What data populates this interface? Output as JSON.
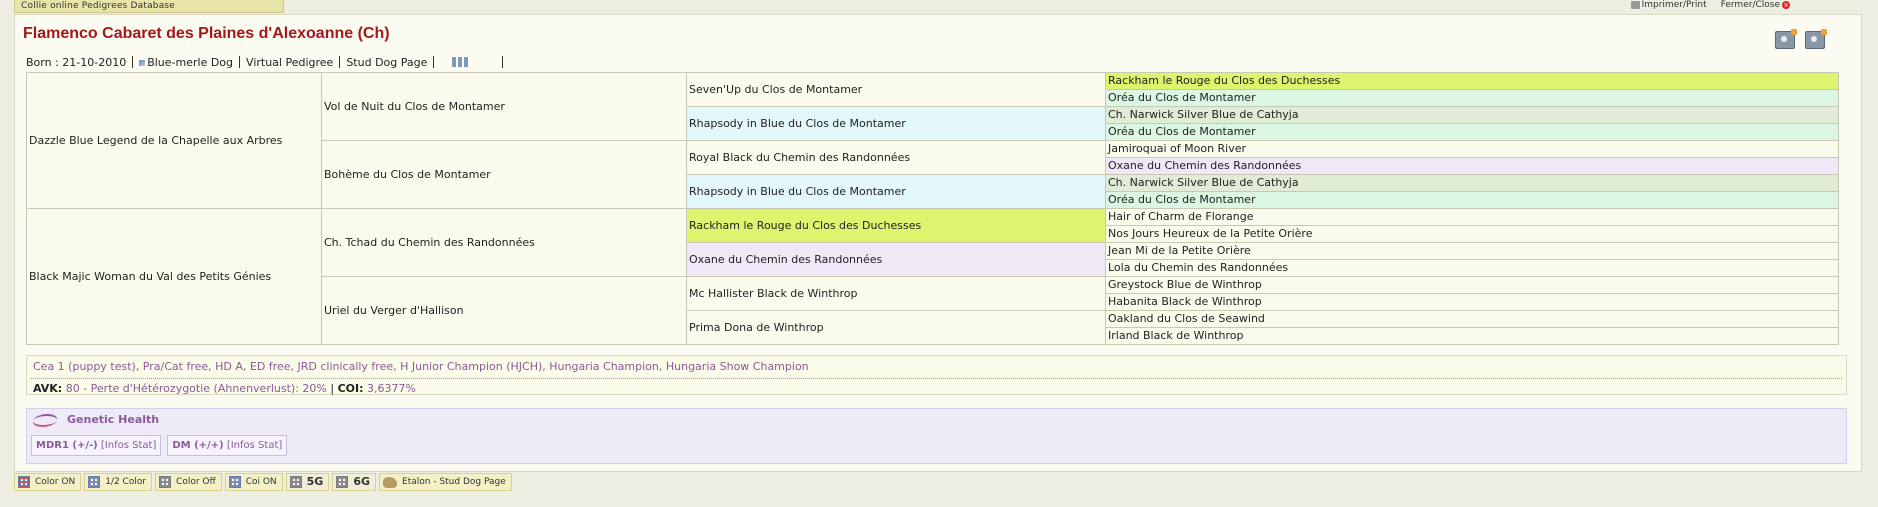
{
  "database_tab": "Collie online Pedigrees Database",
  "top_links": {
    "print": "Imprimer/Print",
    "close": "Fermer/Close"
  },
  "dog": {
    "name": "Flamenco Cabaret des Plaines d'Alexoanne (Ch)",
    "born": "Born : 21-10-2010",
    "color": "Blue-merle Dog",
    "virtual_pedigree": "Virtual Pedigree",
    "stud_dog_page": "Stud Dog Page"
  },
  "pedigree": {
    "g1": [
      "Dazzle Blue Legend de la Chapelle aux Arbres",
      "Black Majic Woman du Val des Petits Génies"
    ],
    "g2": [
      "Vol de Nuit du Clos de Montamer",
      "Bohème du Clos de Montamer",
      "Ch. Tchad du Chemin des Randonnées",
      "Uriel du Verger d'Hallison"
    ],
    "g3": [
      "Seven'Up du Clos de Montamer",
      "Rhapsody in Blue du Clos de Montamer",
      "Royal Black du Chemin des Randonnées",
      "Rhapsody in Blue du Clos de Montamer",
      "Rackham le Rouge du Clos des Duchesses",
      "Oxane du Chemin des Randonnées",
      "Mc Hallister Black de Winthrop",
      "Prima Dona de Winthrop"
    ],
    "g4": [
      "Rackham le Rouge du Clos des Duchesses",
      "Oréa du Clos de Montamer",
      "Ch. Narwick Silver Blue de Cathyja",
      "Oréa du Clos de Montamer",
      "Jamiroquai of Moon River",
      "Oxane du Chemin des Randonnées",
      "Ch. Narwick Silver Blue de Cathyja",
      "Oréa du Clos de Montamer",
      "Hair of Charm de Florange",
      "Nos Jours Heureux de la Petite Orière",
      "Jean Mi de la Petite Orière",
      "Lola du Chemin des Randonnées",
      "Greystock Blue de Winthrop",
      "Habanita Black de Winthrop",
      "Oakland du Clos de Seawind",
      "Irland Black de Winthrop"
    ]
  },
  "health": {
    "titles": "Cea 1 (puppy test), Pra/Cat free, HD A, ED free, JRD clinically free, H Junior Champion (HJCH), Hungaria Champion, Hungaria Show Champion",
    "avk_label": "AVK:",
    "avk_value": "80",
    "avk_desc": "- Perte d'Hétérozygotie (Ahnenverlust): 20%",
    "coi_label": "COI:",
    "coi_value": "3,6377%"
  },
  "genetic": {
    "title": "Genetic Health",
    "tests": [
      {
        "name": "MDR1 (+/-)",
        "links": "[Infos  Stat]"
      },
      {
        "name": "DM (+/+)",
        "links": "[Infos  Stat]"
      }
    ]
  },
  "bottom_buttons": [
    "Color ON",
    "1/2 Color",
    "Color Off",
    "Coi ON",
    "5G",
    "6G",
    "Etalon - Stud Dog Page"
  ],
  "colors": {
    "title": "#a3171b",
    "highlight": "#dff36e",
    "cyan": "#e3f8fb",
    "green": "#dcf6e4",
    "lavender": "#f1e8f7"
  }
}
